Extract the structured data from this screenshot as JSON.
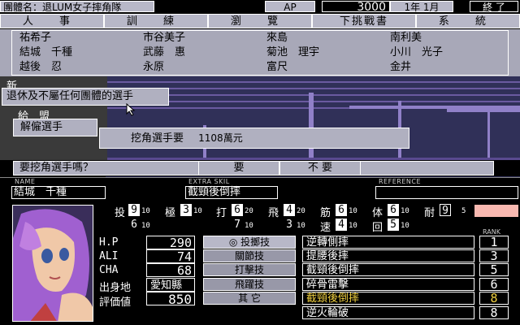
{
  "topbar": {
    "team_label": "團體名：",
    "team_name": "退LUM女子摔角隊",
    "ap_label": "AP",
    "ap_value": "3000",
    "date": "1年 1月",
    "end_button": "終 了"
  },
  "menu": [
    "人 事",
    "訓 練",
    "瀏 覽",
    "下挑戰書",
    "系 統"
  ],
  "name_list": [
    [
      "祐希子",
      "市谷美子",
      "來島",
      "南利美"
    ],
    [
      "結城　千種",
      "武藤　惠",
      "菊池　理宇",
      "小川　光子"
    ],
    [
      "越後　忍",
      "永原",
      "富尺",
      "金井"
    ]
  ],
  "popups": {
    "partial": "新",
    "retire": "退休及不屬任何團體的選手",
    "fire": "解僱選手",
    "partial2": "給　盟",
    "recruit_cost_label": "挖角選手要",
    "recruit_cost_value": "1108萬元"
  },
  "confirm": {
    "question": "要挖角選手嗎？",
    "yes": "要",
    "no": "不 要"
  },
  "headers": {
    "name_label": "NAME",
    "skill_label": "EXTRA SKIL",
    "ref_label": "REFERENCE",
    "name_value": "結城　千種",
    "skill_value": "截頸後倒摔",
    "ref_value": ""
  },
  "stats": [
    {
      "label": "投",
      "val": "9",
      "max": "10"
    },
    {
      "label": "極",
      "val": "3",
      "max": "10"
    },
    {
      "label": "打",
      "val": "6",
      "max": "20"
    },
    {
      "label": "飛",
      "val": "4",
      "max": "20"
    },
    {
      "label": "筋",
      "val": "6",
      "max": "10"
    },
    {
      "label": "体",
      "val": "6",
      "max": "10"
    },
    {
      "label": "耐",
      "val": "9",
      "max": "5"
    }
  ],
  "stats2": [
    {
      "label": "",
      "val": "6",
      "max": "10"
    },
    {
      "label": "",
      "val": "7",
      "max": "10"
    },
    {
      "label": "",
      "val": "3",
      "max": "10"
    },
    {
      "label": "速",
      "val": "4",
      "max": "10"
    },
    {
      "label": "回",
      "val": "5",
      "max": "10"
    }
  ],
  "left_stats": [
    {
      "label": "H.P",
      "value": "290"
    },
    {
      "label": "ALI",
      "value": "74"
    },
    {
      "label": "CHA",
      "value": "68"
    },
    {
      "label": "出身地",
      "value": "愛知縣"
    },
    {
      "label": "評価値",
      "value": "850"
    }
  ],
  "techniques": [
    "◎ 投擲技",
    "關節技",
    "打擊技",
    "飛躍技",
    "其 它"
  ],
  "rank_label": "RANK",
  "moves": [
    {
      "name": "逆轉側摔",
      "rank": "1",
      "color": "#ffffff"
    },
    {
      "name": "提腰後摔",
      "rank": "3",
      "color": "#ffffff"
    },
    {
      "name": "截頸後倒摔",
      "rank": "5",
      "color": "#ffffff"
    },
    {
      "name": "碎骨雷擊",
      "rank": "6",
      "color": "#ffffff"
    },
    {
      "name": "截頸後倒摔",
      "rank": "8",
      "color": "#f0d040"
    },
    {
      "name": "逆火輪破",
      "rank": "8",
      "color": "#ffffff"
    }
  ]
}
